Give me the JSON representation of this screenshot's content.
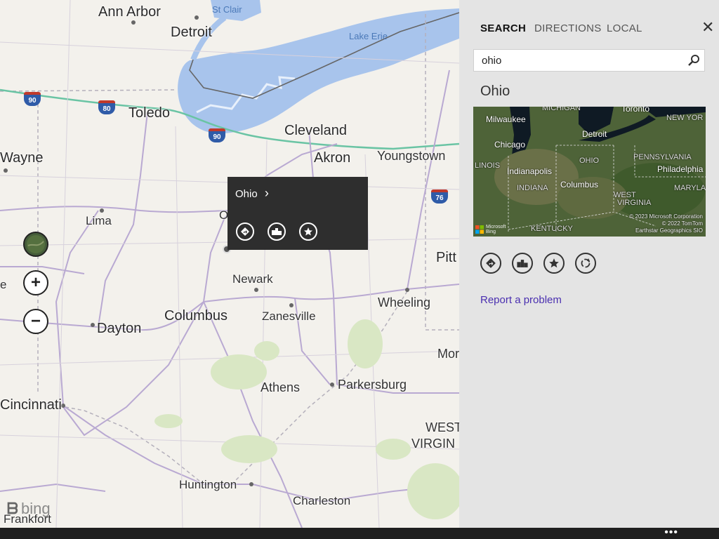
{
  "map": {
    "labels": [
      {
        "text": "Ann Arbor",
        "cls": "big"
      },
      {
        "text": "Detroit",
        "cls": "big"
      },
      {
        "text": "St Clair",
        "cls": "water"
      },
      {
        "text": "Lake Erie",
        "cls": "water"
      },
      {
        "text": "Toledo",
        "cls": "big"
      },
      {
        "text": "Cleveland",
        "cls": "big"
      },
      {
        "text": "Akron",
        "cls": "big"
      },
      {
        "text": "Youngstown",
        "cls": "med"
      },
      {
        "text": "Wayne",
        "cls": "big"
      },
      {
        "text": "Lima",
        "cls": "sm"
      },
      {
        "text": "Pitt",
        "cls": "big"
      },
      {
        "text": "Newark",
        "cls": "sm"
      },
      {
        "text": "Wheeling",
        "cls": "med"
      },
      {
        "text": "Dayton",
        "cls": "big"
      },
      {
        "text": "Columbus",
        "cls": "big"
      },
      {
        "text": "Zanesville",
        "cls": "sm"
      },
      {
        "text": "Mor",
        "cls": "med"
      },
      {
        "text": "Athens",
        "cls": "med"
      },
      {
        "text": "Parkersburg",
        "cls": "med"
      },
      {
        "text": "Cincinnati",
        "cls": "big"
      },
      {
        "text": "WEST",
        "cls": "med"
      },
      {
        "text": "VIRGIN",
        "cls": "med"
      },
      {
        "text": "Huntington",
        "cls": "sm"
      },
      {
        "text": "Charleston",
        "cls": "sm"
      },
      {
        "text": "Frankfort",
        "cls": "sm"
      },
      {
        "text": "e",
        "cls": "sm"
      },
      {
        "text": "O",
        "cls": "sm"
      }
    ],
    "shields": [
      {
        "num": "90",
        "type": "i"
      },
      {
        "num": "80",
        "type": "i"
      },
      {
        "num": "90",
        "type": "i"
      },
      {
        "num": "76",
        "type": "i"
      }
    ],
    "controls": {
      "zoom_in": "+",
      "zoom_out": "−"
    },
    "popup": {
      "title": "Ohio",
      "chevron": "›"
    },
    "logo": "bing"
  },
  "panel": {
    "tabs": [
      "SEARCH",
      "DIRECTIONS",
      "LOCAL"
    ],
    "close": "✕",
    "search": {
      "value": "ohio",
      "placeholder": ""
    },
    "result_title": "Ohio",
    "thumbnail": {
      "labels": [
        "MICHIGAN",
        "Toronto",
        "Milwaukee",
        "NEW YOR",
        "Detroit",
        "Chicago",
        "LINOIS",
        "OHIO",
        "PENNSYLVANIA",
        "Indianapolis",
        "Philadelphia",
        "Columbus",
        "INDIANA",
        "MARYLAN",
        "WEST",
        "VIRGINIA",
        "KENTUCKY"
      ],
      "copyright": [
        "© 2023 Microsoft Corporation",
        "© 2022 TomTom",
        "Earthstar Geographics SIO"
      ],
      "brand": [
        "Microsoft",
        "Bing"
      ]
    },
    "report": "Report a problem"
  },
  "appbar": {
    "more": "•••"
  },
  "colors": {
    "water": "#a8c4ec",
    "interstate": "#6ac4a4",
    "road": "#b9a9d2",
    "panel": "#e4e4e4",
    "link": "#4a2fb0"
  }
}
